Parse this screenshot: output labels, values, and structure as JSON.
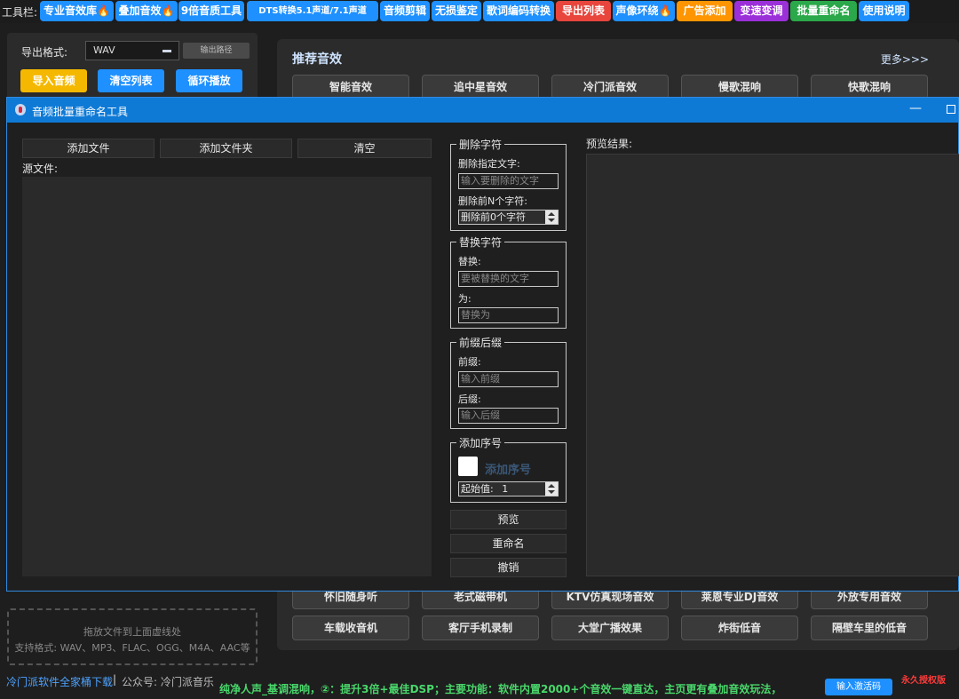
{
  "toolbar": {
    "label": "工具栏:",
    "buttons": [
      {
        "label": "专业音效库🔥",
        "color": "#1e90ff"
      },
      {
        "label": "叠加音效🔥",
        "color": "#1e90ff"
      },
      {
        "label": "9倍音质工具",
        "color": "#1e90ff"
      },
      {
        "label": "DTS转换5.1声道/7.1声道",
        "color": "#1e90ff"
      },
      {
        "label": "音频剪辑",
        "color": "#1e90ff"
      },
      {
        "label": "无损鉴定",
        "color": "#1e90ff"
      },
      {
        "label": "歌词编码转换",
        "color": "#1e90ff"
      },
      {
        "label": "导出列表",
        "color": "#e8453c"
      },
      {
        "label": "声像环绕🔥",
        "color": "#1e90ff"
      },
      {
        "label": "广告添加",
        "color": "#ff9500"
      },
      {
        "label": "变速变调",
        "color": "#9b30d9"
      },
      {
        "label": "批量重命名",
        "color": "#2aa84a"
      },
      {
        "label": "使用说明",
        "color": "#1e90ff"
      }
    ]
  },
  "left_panel": {
    "export_format_label": "导出格式:",
    "export_format_value": "WAV",
    "export_path_button": "输出路径",
    "import_button": "导入音频",
    "clear_list_button": "清空列表",
    "loop_play_button": "循环播放",
    "import_color": "#f5b800",
    "blue_color": "#1e90ff"
  },
  "recommended": {
    "title": "推荐音效",
    "more": "更多>>>",
    "row1": [
      "智能音效",
      "追中星音效",
      "冷门派音效",
      "慢歌混响",
      "快歌混响"
    ],
    "row2": [
      "怀旧随身听",
      "老式磁带机",
      "KTV仿真现场音效",
      "莱恩专业DJ音效",
      "外放专用音效"
    ],
    "row3": [
      "车载收音机",
      "客厅手机录制",
      "大堂广播效果",
      "炸街低音",
      "隔壁车里的低音"
    ]
  },
  "drop_zone": {
    "line1": "拖放文件到上面虚线处",
    "line2": "支持格式: WAV、MP3、FLAC、OGG、M4A、AAC等"
  },
  "footer": {
    "download_link": "冷门派软件全家桶下载",
    "separator": "|",
    "public_account": "公众号: 冷门派音乐",
    "marquee": "纯净人声_基调混响，②：提升3倍+最佳DSP；主要功能：软件内置2000+个音效一键直达，主页更有叠加音效玩法，",
    "activate_button": "输入激活码",
    "license": "永久授权版"
  },
  "dialog": {
    "title": "音频批量重命名工具",
    "add_file_button": "添加文件",
    "add_folder_button": "添加文件夹",
    "clear_button": "清空",
    "source_files_label": "源文件:",
    "preview_label": "预览结果:",
    "delete_group": {
      "legend": "删除字符",
      "specified_label": "删除指定文字:",
      "specified_placeholder": "输入要删除的文字",
      "first_n_label": "删除前N个字符:",
      "first_n_value": "删除前0个字符"
    },
    "replace_group": {
      "legend": "替换字符",
      "replace_label": "替换:",
      "replace_placeholder": "要被替换的文字",
      "with_label": "为:",
      "with_placeholder": "替换为"
    },
    "affix_group": {
      "legend": "前缀后缀",
      "prefix_label": "前缀:",
      "prefix_placeholder": "输入前缀",
      "suffix_label": "后缀:",
      "suffix_placeholder": "输入后缀"
    },
    "seq_group": {
      "legend": "添加序号",
      "checkbox_label": "添加序号",
      "start_label": "起始值:",
      "start_value": "1"
    },
    "preview_button": "预览",
    "rename_button": "重命名",
    "undo_button": "撤销"
  }
}
